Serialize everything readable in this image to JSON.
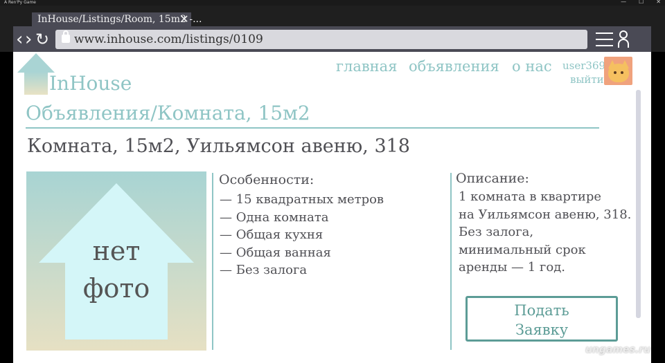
{
  "window": {
    "title": "A Ren'Py Game",
    "controls": [
      "—",
      "☐",
      "✕"
    ]
  },
  "browser": {
    "tab_title": "InHouse/Listings/Room, 15m2 -...",
    "tab_close": "✕",
    "back_glyph": "‹",
    "forward_glyph": "›",
    "reload_glyph": "↻",
    "url": "www.inhouse.com/listings/0109",
    "icons": [
      "back-icon",
      "forward-icon",
      "reload-icon",
      "lock-icon",
      "menu-icon",
      "user-icon"
    ]
  },
  "site": {
    "logo_text": "InHouse",
    "nav": [
      "главная",
      "объявления",
      "о нас"
    ],
    "user": {
      "name": "user369",
      "logout": "выйти"
    },
    "breadcrumb": "Объявления/Комната, 15м2",
    "listing_title": "Комната, 15м2, Уильямсон авеню, 318",
    "photo": {
      "line1": "нет",
      "line2": "фото"
    },
    "features": {
      "heading": "Особенности:",
      "items": [
        "— 15 квадратных метров",
        "— Одна комната",
        "— Общая кухня",
        "— Общая ванная",
        "— Без залога"
      ]
    },
    "description": {
      "heading": "Описание:",
      "lines": [
        "1 комната в квартире",
        "на Уильямсон авеню, 318.",
        "Без залога,",
        "минимальный срок",
        "аренды — 1 год."
      ]
    },
    "apply_button": {
      "line1": "Подать",
      "line2": "Заявку"
    }
  },
  "watermark": "ungames.ru",
  "colors": {
    "accent": "#8fc5c5",
    "button": "#5c9c96",
    "text": "#505055",
    "chrome": "#4a4a55"
  }
}
